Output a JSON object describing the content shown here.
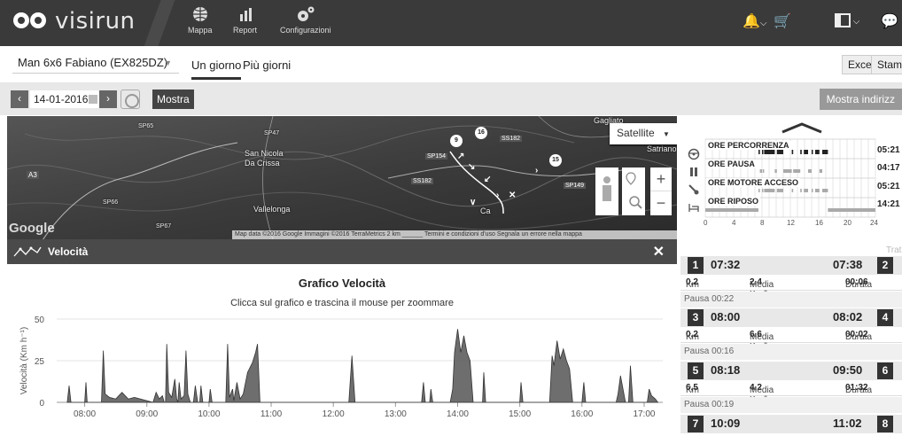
{
  "nav": {
    "brand": "visirun",
    "items": [
      {
        "label": "Mappa",
        "icon": "globe-icon"
      },
      {
        "label": "Report",
        "icon": "bar-chart-icon"
      },
      {
        "label": "Configurazioni",
        "icon": "gears-icon"
      }
    ]
  },
  "toolbar": {
    "vehicle": "Man 6x6 Fabiano (EX825DZ)",
    "tab_one_day": "Un giorno",
    "tab_more_days": "Più giorni",
    "excel": "Excel",
    "print": "Stamp"
  },
  "datebar": {
    "date": "14-01-2016",
    "show": "Mostra",
    "show_addresses": "Mostra indirizz"
  },
  "map": {
    "map_type": "Satellite",
    "google": "Google",
    "places": [
      "SP65",
      "SP47",
      "San Nicola",
      "Da Crissa",
      "Vallelonga",
      "SP66",
      "SP67",
      "SP154",
      "SS182",
      "SS182",
      "SP149",
      "Satriano",
      "Gagliato",
      "A3",
      "Ca"
    ],
    "attribution": "Map data ©2016 Google Immagini ©2016 TerraMetrics   2 km ______   Termini e condizioni d'uso   Segnala un errore nella mappa",
    "markers": [
      "9",
      "16",
      "15"
    ]
  },
  "velocity": {
    "panel_title": "Velocità",
    "chart_title": "Grafico Velocità",
    "chart_subtitle": "Clicca sul grafico e trascina il mouse per zoommare"
  },
  "chart_data": {
    "type": "area",
    "title": "Grafico Velocità",
    "subtitle": "Clicca sul grafico e trascina il mouse per zoommare",
    "ylabel": "Velocità (Km h⁻¹)",
    "xlabel": "",
    "ylim": [
      0,
      50
    ],
    "yticks": [
      0,
      25,
      50
    ],
    "xticks": [
      "08:00",
      "09:00",
      "10:00",
      "11:00",
      "12:00",
      "13:00",
      "14:00",
      "15:00",
      "16:00",
      "17:00"
    ],
    "xrange_hours": [
      7.55,
      17.3
    ],
    "grid": true,
    "color": "#555555",
    "series": [
      {
        "values": [
          [
            7.72,
            0
          ],
          [
            7.75,
            10
          ],
          [
            7.78,
            0
          ],
          [
            8.0,
            0
          ],
          [
            8.02,
            12
          ],
          [
            8.04,
            0
          ],
          [
            8.27,
            0
          ],
          [
            8.3,
            31
          ],
          [
            8.33,
            5
          ],
          [
            8.4,
            3
          ],
          [
            8.5,
            2
          ],
          [
            8.6,
            6
          ],
          [
            8.7,
            2
          ],
          [
            8.8,
            3
          ],
          [
            8.9,
            2
          ],
          [
            9.0,
            1
          ],
          [
            9.1,
            0
          ],
          [
            9.15,
            6
          ],
          [
            9.2,
            2
          ],
          [
            9.25,
            4
          ],
          [
            9.28,
            0
          ],
          [
            9.3,
            0
          ],
          [
            9.32,
            35
          ],
          [
            9.35,
            6
          ],
          [
            9.4,
            3
          ],
          [
            9.45,
            14
          ],
          [
            9.48,
            2
          ],
          [
            9.5,
            0
          ],
          [
            9.52,
            12
          ],
          [
            9.55,
            2
          ],
          [
            9.6,
            4
          ],
          [
            9.63,
            31
          ],
          [
            9.66,
            5
          ],
          [
            9.7,
            0
          ],
          [
            9.75,
            0
          ],
          [
            9.78,
            10
          ],
          [
            9.82,
            0
          ],
          [
            9.85,
            0
          ],
          [
            9.87,
            10
          ],
          [
            9.9,
            0
          ],
          [
            10.0,
            0
          ],
          [
            10.02,
            8
          ],
          [
            10.05,
            0
          ],
          [
            10.27,
            0
          ],
          [
            10.3,
            35
          ],
          [
            10.33,
            3
          ],
          [
            10.38,
            8
          ],
          [
            10.4,
            1
          ],
          [
            10.45,
            12
          ],
          [
            10.5,
            2
          ],
          [
            10.55,
            5
          ],
          [
            10.62,
            18
          ],
          [
            10.7,
            24
          ],
          [
            10.75,
            30
          ],
          [
            10.78,
            35
          ],
          [
            10.82,
            0
          ],
          [
            12.25,
            0
          ],
          [
            12.3,
            28
          ],
          [
            12.35,
            0
          ],
          [
            13.42,
            0
          ],
          [
            13.45,
            12
          ],
          [
            13.48,
            0
          ],
          [
            13.55,
            0
          ],
          [
            13.57,
            8
          ],
          [
            13.6,
            0
          ],
          [
            13.88,
            0
          ],
          [
            13.92,
            8
          ],
          [
            13.95,
            30
          ],
          [
            14.0,
            44
          ],
          [
            14.05,
            30
          ],
          [
            14.1,
            40
          ],
          [
            14.15,
            30
          ],
          [
            14.2,
            25
          ],
          [
            14.25,
            0
          ],
          [
            14.4,
            0
          ],
          [
            14.42,
            18
          ],
          [
            14.45,
            0
          ],
          [
            15.0,
            0
          ],
          [
            15.02,
            12
          ],
          [
            15.05,
            0
          ],
          [
            15.48,
            0
          ],
          [
            15.52,
            28
          ],
          [
            15.55,
            22
          ],
          [
            15.6,
            37
          ],
          [
            15.65,
            26
          ],
          [
            15.7,
            32
          ],
          [
            15.75,
            25
          ],
          [
            15.8,
            20
          ],
          [
            15.85,
            0
          ],
          [
            16.0,
            0
          ],
          [
            16.03,
            12
          ],
          [
            16.06,
            0
          ],
          [
            16.55,
            0
          ],
          [
            16.58,
            5
          ],
          [
            16.62,
            16
          ],
          [
            16.65,
            10
          ],
          [
            16.7,
            0
          ],
          [
            16.75,
            0
          ],
          [
            16.78,
            22
          ],
          [
            16.82,
            0
          ],
          [
            17.05,
            0
          ],
          [
            17.08,
            8
          ],
          [
            17.12,
            4
          ],
          [
            17.18,
            2
          ],
          [
            17.22,
            0
          ]
        ]
      }
    ]
  },
  "hours": {
    "rows": [
      {
        "label": "ORE PERCORRENZA",
        "value": "05:21",
        "icon": "steering-wheel-icon"
      },
      {
        "label": "ORE PAUSA",
        "value": "04:17",
        "icon": "pause-icon"
      },
      {
        "label": "ORE MOTORE ACCESO",
        "value": "05:21",
        "icon": "engine-icon"
      },
      {
        "label": "ORE RIPOSO",
        "value": "14:21",
        "icon": "bed-icon"
      }
    ],
    "ticks": [
      "0",
      "4",
      "8",
      "12",
      "16",
      "20",
      "24"
    ]
  },
  "segments_label": "Trat",
  "segments": [
    {
      "start_num": "1",
      "start": "07:32",
      "end": "07:38",
      "end_num": "2",
      "km": "0,2",
      "media": "2,4",
      "durata": "00:06",
      "pausa": "Pausa 00:22"
    },
    {
      "start_num": "3",
      "start": "08:00",
      "end": "08:02",
      "end_num": "4",
      "km": "0,2",
      "media": "6,6",
      "durata": "00:02",
      "pausa": "Pausa 00:16"
    },
    {
      "start_num": "5",
      "start": "08:18",
      "end": "09:50",
      "end_num": "6",
      "km": "6,5",
      "media": "4,2",
      "durata": "01:32",
      "pausa": "Pausa 00:19"
    },
    {
      "start_num": "7",
      "start": "10:09",
      "end": "11:02",
      "end_num": "8"
    }
  ],
  "seg_labels": {
    "km": "Km",
    "media": "Media Km/h",
    "durata": "Durata"
  }
}
